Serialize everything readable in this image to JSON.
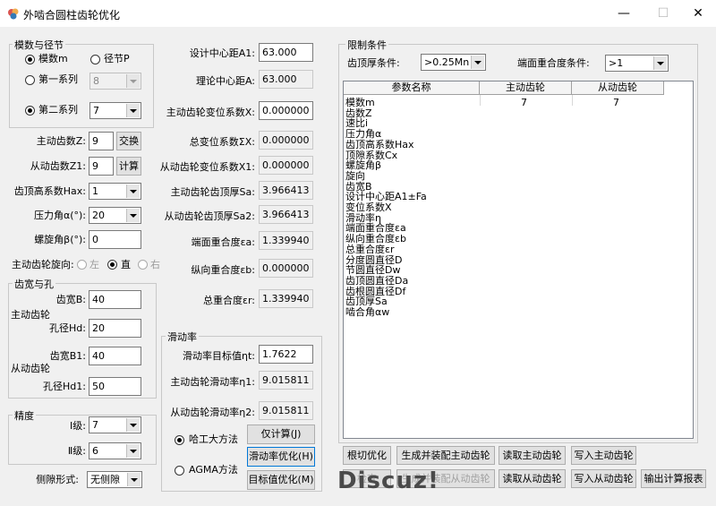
{
  "window": {
    "title": "外啮合圆柱齿轮优化",
    "minimize": "—",
    "maximize": "☐",
    "close": "✕"
  },
  "module": {
    "group_label": "模数与径节",
    "opt_module": "模数m",
    "opt_pitch": "径节P",
    "series1_label": "第一系列",
    "series1_value": "8",
    "series2_label": "第二系列",
    "series2_value": "7"
  },
  "teeth": {
    "z_label": "主动齿数Z:",
    "z_value": "9",
    "swap_btn": "交换",
    "z1_label": "从动齿数Z1:",
    "z1_value": "9",
    "calc_btn": "计算",
    "hax_label": "齿顶高系数Hax:",
    "hax_value": "1",
    "alpha_label": "压力角α(°):",
    "alpha_value": "20",
    "beta_label": "螺旋角β(°):",
    "beta_value": "0",
    "hand_label": "主动齿轮旋向:",
    "hand_left": "左",
    "hand_straight": "直",
    "hand_right": "右"
  },
  "width": {
    "group_label": "齿宽与孔",
    "driving_label": "主动齿轮",
    "b_label": "齿宽B:",
    "b_value": "40",
    "hd_label": "孔径Hd:",
    "hd_value": "20",
    "driven_label": "从动齿轮",
    "b1_label": "齿宽B1:",
    "b1_value": "40",
    "hd1_label": "孔径Hd1:",
    "hd1_value": "50"
  },
  "precision": {
    "group_label": "精度",
    "g1_label": "Ⅰ级:",
    "g1_value": "7",
    "g2_label": "Ⅱ级:",
    "g2_value": "6",
    "clearance_label": "侧隙形式:",
    "clearance_value": "无侧隙"
  },
  "center": {
    "design_label": "设计中心距A1:",
    "design_value": "63.000",
    "theory_label": "理论中心距A:",
    "theory_value": "63.000",
    "x_label": "主动齿轮变位系数X:",
    "x_value": "0.000000",
    "sx_label": "总变位系数ΣX:",
    "sx_value": "0.000000",
    "x1_label": "从动齿轮变位系数X1:",
    "x1_value": "0.000000",
    "sa_label": "主动齿轮齿顶厚Sa:",
    "sa_value": "3.966413",
    "sa2_label": "从动齿轮齿顶厚Sa2:",
    "sa2_value": "3.966413",
    "ea_label": "端面重合度εa:",
    "ea_value": "1.339940",
    "eb_label": "纵向重合度εb:",
    "eb_value": "0.000000",
    "er_label": "总重合度εr:",
    "er_value": "1.339940"
  },
  "sliding": {
    "group_label": "滑动率",
    "target_label": "滑动率目标值ηt:",
    "target_value": "1.7622",
    "n1_label": "主动齿轮滑动率η1:",
    "n1_value": "9.015811",
    "n2_label": "从动齿轮滑动率η2:",
    "n2_value": "9.015811",
    "method_hit": "哈工大方法",
    "method_agma": "AGMA方法",
    "calc_only_btn": "仅计算(J)",
    "opt_btn": "滑动率优化(H)",
    "target_opt_btn": "目标值优化(M)"
  },
  "limits": {
    "group_label": "限制条件",
    "tip_label": "齿顶厚条件:",
    "tip_value": ">0.25Mn",
    "ratio_label": "端面重合度条件:",
    "ratio_value": ">1"
  },
  "table": {
    "headers": [
      "参数名称",
      "主动齿轮",
      "从动齿轮"
    ],
    "rows": [
      "模数m",
      "齿数Z",
      "速比i",
      "压力角α",
      "齿顶高系数Hax",
      "顶隙系数Cx",
      "螺旋角β",
      "旋向",
      "齿宽B",
      "设计中心距A1±Fa",
      "变位系数X",
      "滑动率η",
      "端面重合度εa",
      "纵向重合度εb",
      "总重合度εr",
      "分度圆直径D",
      "节圆直径Dw",
      "齿顶圆直径Da",
      "齿根圆直径Df",
      "齿顶厚Sa",
      "啮合角αw"
    ],
    "first_row_values": [
      "7",
      "7"
    ]
  },
  "buttons": {
    "root_opt": "根切优化",
    "gen_driving": "生成并装配主动齿轮",
    "read_driving": "读取主动齿轮",
    "write_driving": "写入主动齿轮",
    "check": "检查",
    "gen_driven": "生成并装配从动齿轮",
    "read_driven": "读取从动齿轮",
    "write_driven": "写入从动齿轮",
    "export": "输出计算报表"
  },
  "watermark": "Discuz!"
}
